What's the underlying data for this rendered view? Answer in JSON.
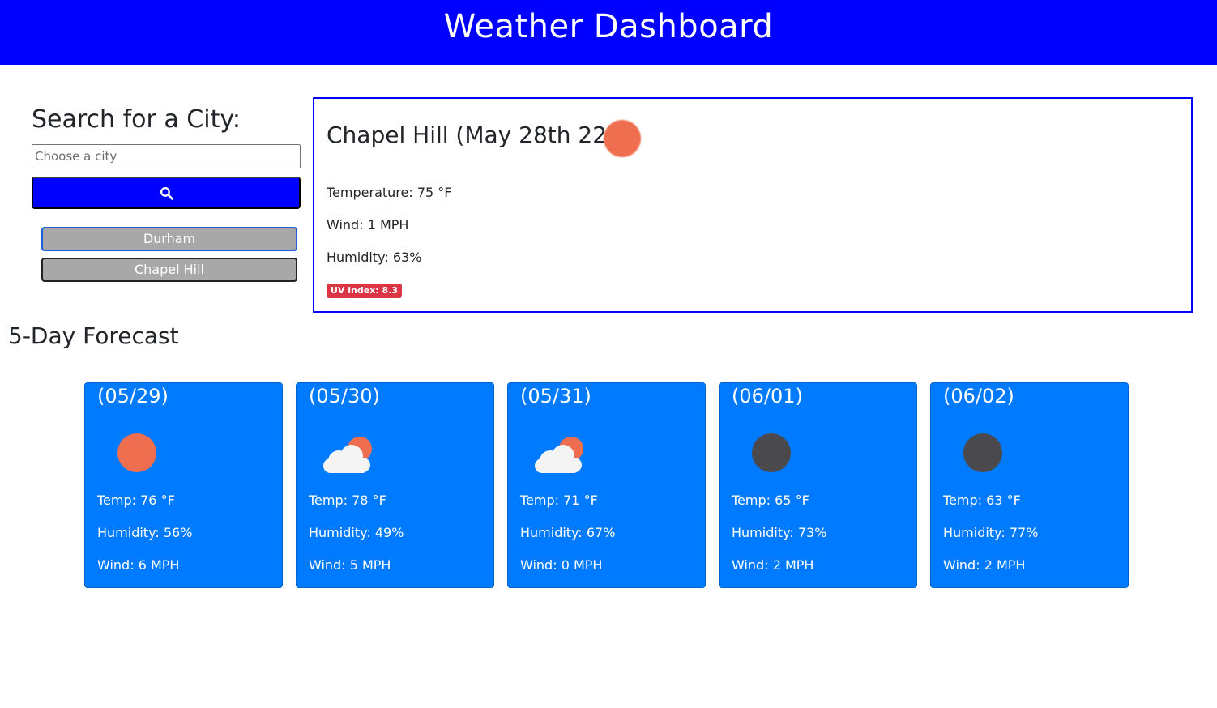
{
  "header": {
    "title": "Weather Dashboard"
  },
  "search": {
    "title": "Search for a City:",
    "placeholder": "Choose a city",
    "value": "",
    "button_icon": "search-icon"
  },
  "history": [
    {
      "label": "Durham"
    },
    {
      "label": "Chapel Hill"
    }
  ],
  "current": {
    "heading": "Chapel Hill (May 28th 22)",
    "icon": "sun-icon",
    "temperature": "Temperature: 75 °F",
    "wind": "Wind: 1 MPH",
    "humidity": "Humidity: 63%",
    "uv": "UV index: 8.3"
  },
  "forecast": {
    "title": "5-Day Forecast",
    "days": [
      {
        "date": "(05/29)",
        "icon": "sun-icon",
        "temp": "Temp: 76 °F",
        "humidity": "Humidity: 56%",
        "wind": "Wind: 6 MPH"
      },
      {
        "date": "(05/30)",
        "icon": "partly-cloudy-icon",
        "temp": "Temp: 78 °F",
        "humidity": "Humidity: 49%",
        "wind": "Wind: 5 MPH"
      },
      {
        "date": "(05/31)",
        "icon": "partly-cloudy-icon",
        "temp": "Temp: 71 °F",
        "humidity": "Humidity: 67%",
        "wind": "Wind: 0 MPH"
      },
      {
        "date": "(06/01)",
        "icon": "moon-icon",
        "temp": "Temp: 65 °F",
        "humidity": "Humidity: 73%",
        "wind": "Wind: 2 MPH"
      },
      {
        "date": "(06/02)",
        "icon": "moon-icon",
        "temp": "Temp: 63 °F",
        "humidity": "Humidity: 77%",
        "wind": "Wind: 2 MPH"
      }
    ]
  },
  "colors": {
    "header_bg": "#0000ff",
    "search_button_bg": "#0000ff",
    "history_button_bg": "#a8a8a8",
    "forecast_card_bg": "#007bff",
    "uv_badge_bg": "#dc3545",
    "sun": "#ee6e4f",
    "moon": "#4a4a4e"
  }
}
